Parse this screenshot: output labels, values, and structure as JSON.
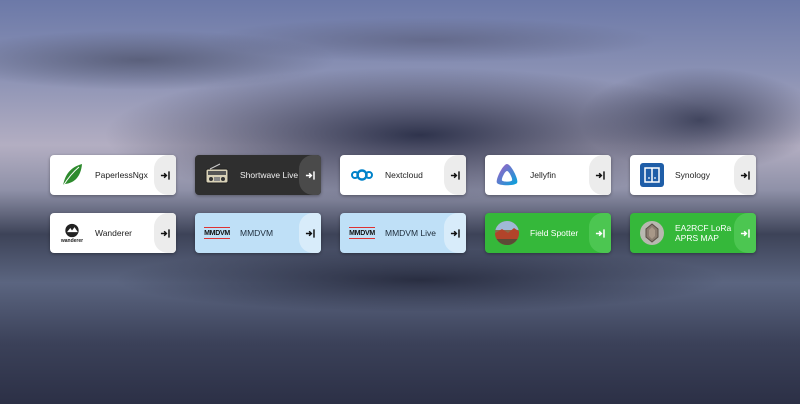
{
  "tiles": [
    {
      "name": "PaperlessNgx",
      "style": "white",
      "icon": "leaf-icon"
    },
    {
      "name": "Shortwave Live",
      "style": "dark",
      "icon": "radio-icon"
    },
    {
      "name": "Nextcloud",
      "style": "white",
      "icon": "nextcloud-icon"
    },
    {
      "name": "Jellyfin",
      "style": "white",
      "icon": "jellyfin-icon"
    },
    {
      "name": "Synology",
      "style": "white",
      "icon": "synology-icon"
    },
    {
      "name": "Wanderer",
      "style": "white",
      "icon": "wanderer-icon",
      "icon_text": "wanderer"
    },
    {
      "name": "MMDVM",
      "style": "blue",
      "icon": "mmdvm-icon",
      "icon_text": "MMDVM"
    },
    {
      "name": "MMDVM Live",
      "style": "blue",
      "icon": "mmdvm-icon",
      "icon_text": "MMDVM"
    },
    {
      "name": "Field Spotter",
      "style": "green",
      "icon": "field-photo-icon"
    },
    {
      "name": "EA2RCF LoRa APRS MAP",
      "style": "green",
      "icon": "lora-avatar-icon"
    }
  ],
  "launch_icon": "launch-icon",
  "colors": {
    "tile_white": "#ffffff",
    "tile_dark": "#2f2f2f",
    "tile_blue": "#bfe0f7",
    "tile_green": "#35b83a"
  }
}
